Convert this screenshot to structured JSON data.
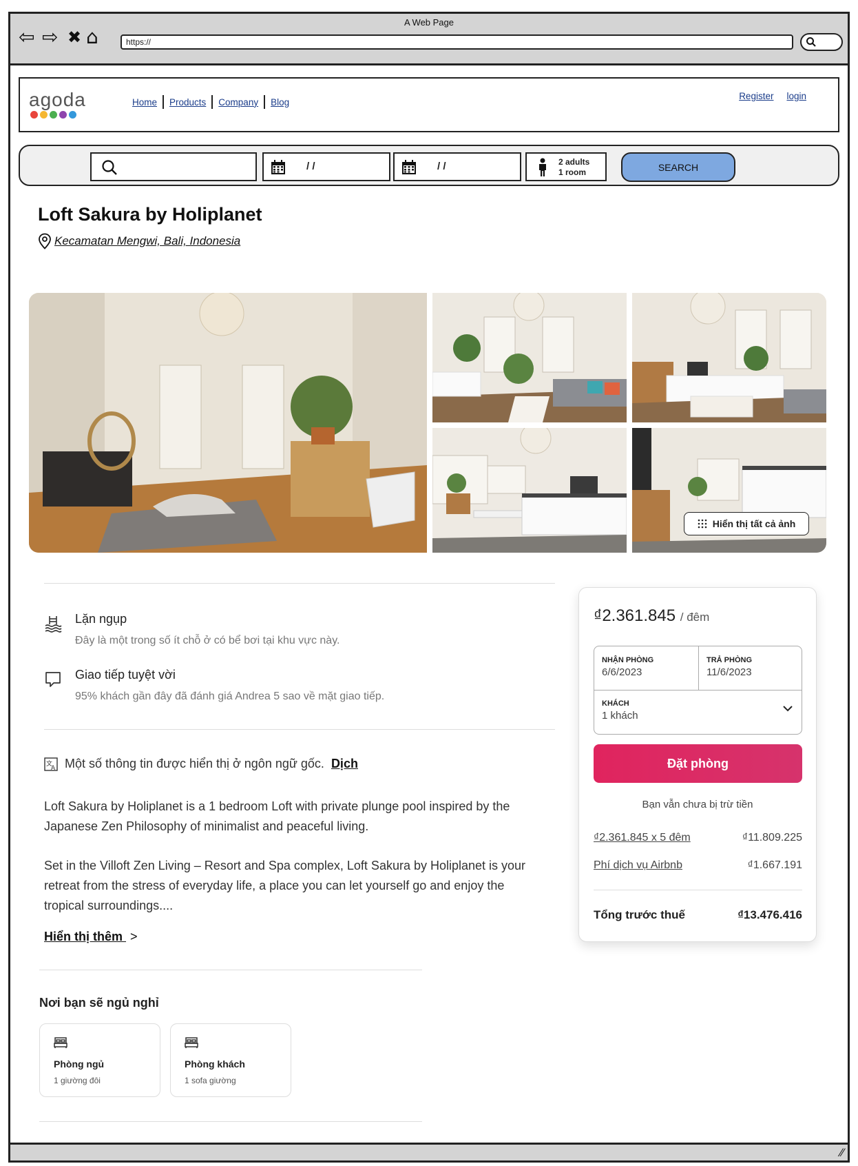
{
  "browser": {
    "window_title": "A Web Page",
    "url": "https://",
    "nav": {
      "back": "⇦",
      "forward": "⇨",
      "stop": "✖",
      "home": "⌂"
    }
  },
  "header": {
    "logo": "agoda",
    "logo_dot_colors": [
      "#e8453c",
      "#f5b731",
      "#4caf50",
      "#8e44ad",
      "#3498db"
    ],
    "nav": {
      "home": "Home",
      "products": "Products",
      "company": "Company",
      "blog": "Blog"
    },
    "register": "Register",
    "login": "login"
  },
  "search": {
    "checkin": "/ /",
    "checkout": "/ /",
    "guests_line1": "2 adults",
    "guests_line2": "1 room",
    "button": "SEARCH"
  },
  "listing": {
    "title": "Loft Sakura by Holiplanet",
    "location": "Kecamatan Mengwi, Bali, Indonesia",
    "show_all_photos": "Hiển thị tất cả ảnh",
    "features": [
      {
        "title": "Lặn ngụp",
        "desc": "Đây là một trong số ít chỗ ở có bể bơi tại khu vực này."
      },
      {
        "title": "Giao tiếp tuyệt vời",
        "desc": "95% khách gần đây đã đánh giá Andrea 5 sao về mặt giao tiếp."
      }
    ],
    "translate_note": "Một số thông tin được hiển thị ở ngôn ngữ gốc.",
    "translate_link": "Dịch",
    "description_1": "Loft Sakura by Holiplanet is a 1 bedroom Loft with private plunge pool inspired by the Japanese Zen Philosophy of minimalist and peaceful living.",
    "description_2": "Set in the Villoft Zen Living – Resort and Spa complex, Loft Sakura by Holiplanet is your retreat from the stress of everyday life, a place you can let yourself go and enjoy the tropical surroundings....",
    "show_more": "Hiển thị thêm",
    "show_more_chevron": ">",
    "sleep_heading": "Nơi bạn sẽ ngủ nghỉ",
    "sleep_cards": [
      {
        "title": "Phòng ngủ",
        "sub": "1 giường đôi"
      },
      {
        "title": "Phòng khách",
        "sub": "1 sofa giường"
      }
    ]
  },
  "booking": {
    "price": "₫2.361.845",
    "per": "/ đêm",
    "checkin_label": "NHẬN PHÒNG",
    "checkin_value": "6/6/2023",
    "checkout_label": "TRẢ PHÒNG",
    "checkout_value": "11/6/2023",
    "guests_label": "KHÁCH",
    "guests_value": "1 khách",
    "book_button": "Đặt phòng",
    "no_charge": "Bạn vẫn chưa bị trừ tiền",
    "nights_label": "₫2.361.845 x 5 đêm",
    "nights_value": "₫11.809.225",
    "fee_label": "Phí dịch vụ Airbnb",
    "fee_value": "₫1.667.191",
    "total_label": "Tổng trước thuế",
    "total_value": "₫13.476.416"
  }
}
